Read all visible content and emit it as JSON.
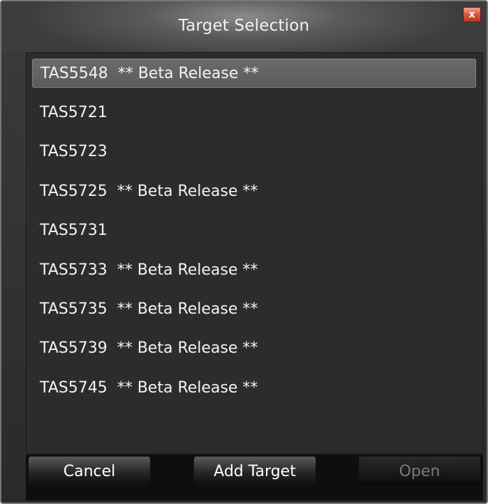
{
  "window": {
    "title": "Target Selection",
    "close_label": "x"
  },
  "targets": [
    {
      "label": "TAS5548  ** Beta Release **",
      "selected": true
    },
    {
      "label": "TAS5721",
      "selected": false
    },
    {
      "label": "TAS5723",
      "selected": false
    },
    {
      "label": "TAS5725  ** Beta Release **",
      "selected": false
    },
    {
      "label": "TAS5731",
      "selected": false
    },
    {
      "label": "TAS5733  ** Beta Release **",
      "selected": false
    },
    {
      "label": "TAS5735  ** Beta Release **",
      "selected": false
    },
    {
      "label": "TAS5739  ** Beta Release **",
      "selected": false
    },
    {
      "label": "TAS5745  ** Beta Release **",
      "selected": false
    }
  ],
  "buttons": {
    "cancel": "Cancel",
    "add_target": "Add Target",
    "open": "Open",
    "open_enabled": false
  },
  "colors": {
    "background": "#2c2c2c",
    "selected_row": "#616161",
    "close_button": "#d8563c"
  }
}
